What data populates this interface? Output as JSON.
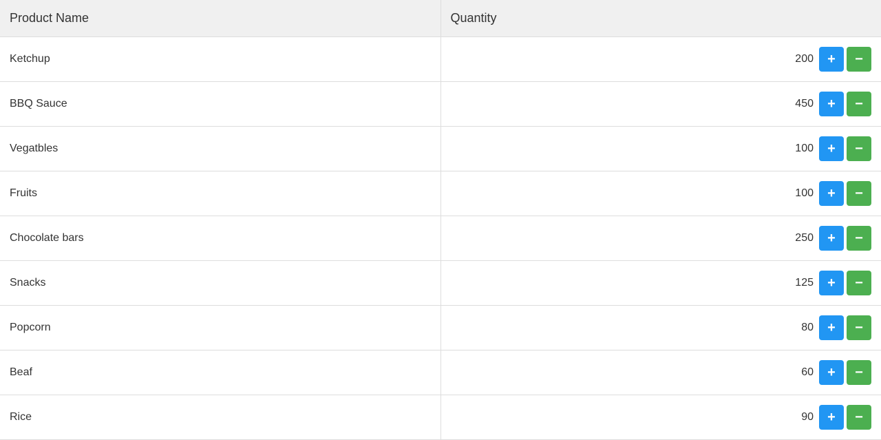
{
  "table": {
    "columns": [
      {
        "label": "Product Name"
      },
      {
        "label": "Quantity"
      }
    ],
    "rows": [
      {
        "product": "Ketchup",
        "quantity": 200
      },
      {
        "product": "BBQ Sauce",
        "quantity": 450
      },
      {
        "product": "Vegatbles",
        "quantity": 100
      },
      {
        "product": "Fruits",
        "quantity": 100
      },
      {
        "product": "Chocolate bars",
        "quantity": 250
      },
      {
        "product": "Snacks",
        "quantity": 125
      },
      {
        "product": "Popcorn",
        "quantity": 80
      },
      {
        "product": "Beaf",
        "quantity": 60
      },
      {
        "product": "Rice",
        "quantity": 90
      }
    ]
  },
  "buttons": {
    "plus_label": "+",
    "minus_label": "−"
  }
}
